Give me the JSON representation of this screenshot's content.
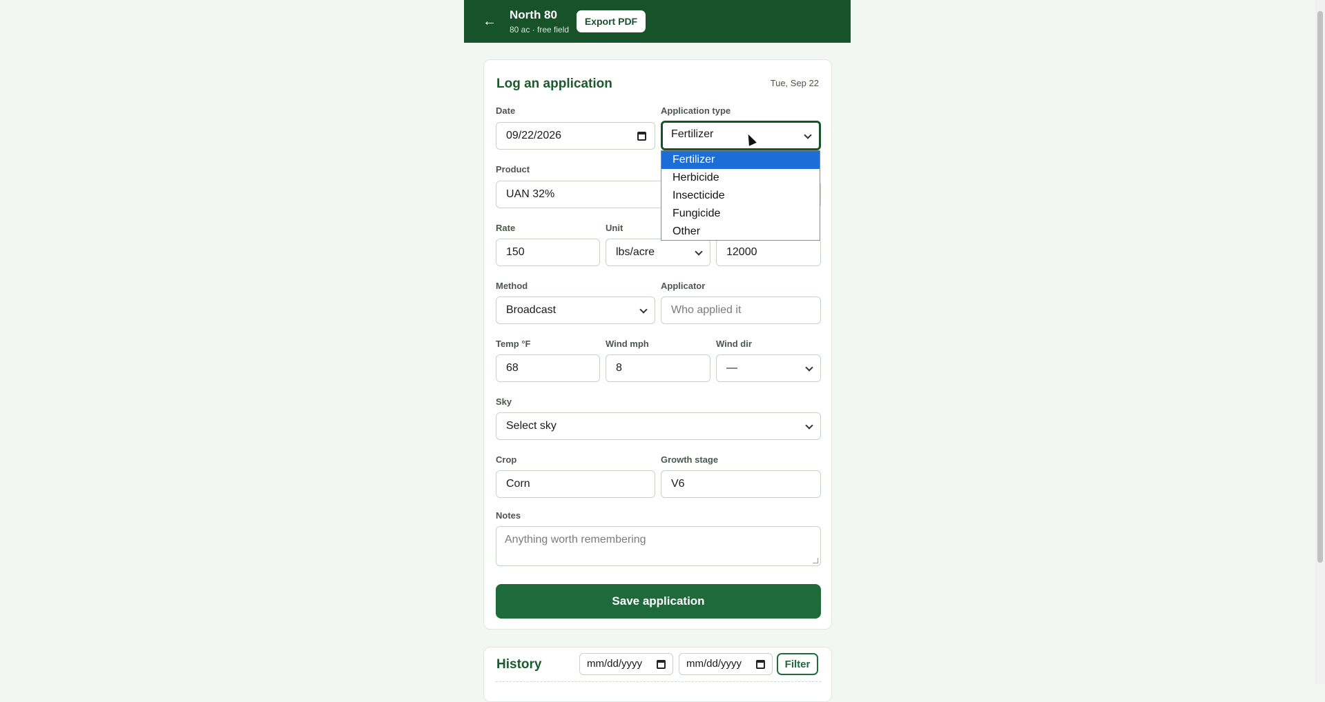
{
  "header": {
    "back_label": "←",
    "field_name": "North 80",
    "field_subtitle": "80 ac · free field",
    "export_label": "Export PDF"
  },
  "form": {
    "title": "Log an application",
    "today": "Tue, Sep 22",
    "date": {
      "label": "Date",
      "value": "09/22/2026"
    },
    "application_type": {
      "label": "Application type",
      "value": "Fertilizer",
      "options": [
        "Fertilizer",
        "Herbicide",
        "Insecticide",
        "Fungicide",
        "Other"
      ]
    },
    "product": {
      "label": "Product",
      "value": "UAN 32%"
    },
    "rate": {
      "label": "Rate",
      "value": "150"
    },
    "unit": {
      "label": "Unit",
      "value": "lbs/acre"
    },
    "total": {
      "value": "12000"
    },
    "method": {
      "label": "Method",
      "value": "Broadcast"
    },
    "applicator": {
      "label": "Applicator",
      "placeholder": "Who applied it"
    },
    "temp": {
      "label": "Temp °F",
      "value": "68"
    },
    "wind_mph": {
      "label": "Wind mph",
      "value": "8"
    },
    "wind_dir": {
      "label": "Wind dir",
      "value": "—"
    },
    "sky": {
      "label": "Sky",
      "value": "Select sky"
    },
    "crop": {
      "label": "Crop",
      "value": "Corn"
    },
    "growth_stage": {
      "label": "Growth stage",
      "value": "V6"
    },
    "notes": {
      "label": "Notes",
      "placeholder": "Anything worth remembering"
    },
    "save_label": "Save application"
  },
  "history": {
    "title": "History",
    "from_placeholder": "mm/dd/yyyy",
    "to_placeholder": "mm/dd/yyyy",
    "filter_label": "Filter"
  }
}
